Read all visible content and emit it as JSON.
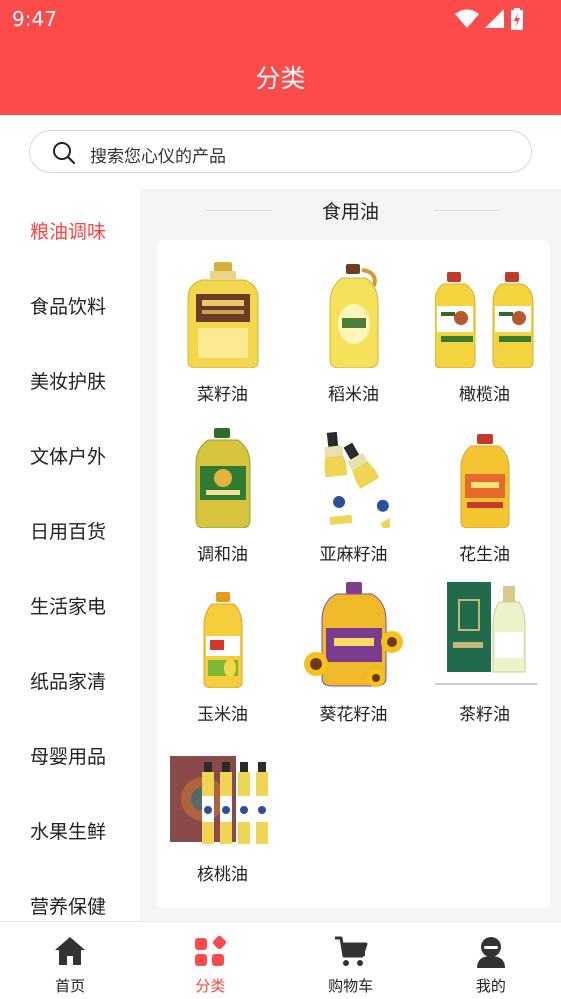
{
  "status_bar": {
    "time": "9:47"
  },
  "header": {
    "title": "分类"
  },
  "search": {
    "placeholder": "搜索您心仪的产品"
  },
  "sidebar": {
    "items": [
      {
        "label": "粮油调味",
        "active": true
      },
      {
        "label": "食品饮料"
      },
      {
        "label": "美妆护肤"
      },
      {
        "label": "文体户外"
      },
      {
        "label": "日用百货"
      },
      {
        "label": "生活家电"
      },
      {
        "label": "纸品家清"
      },
      {
        "label": "母婴用品"
      },
      {
        "label": "水果生鲜"
      },
      {
        "label": "营养保健"
      }
    ]
  },
  "content": {
    "category_title": "食用油",
    "products": [
      {
        "name": "菜籽油",
        "icon": "rapeseed-oil-bottle"
      },
      {
        "name": "稻米油",
        "icon": "rice-bran-oil-bottle"
      },
      {
        "name": "橄榄油",
        "icon": "olive-oil-bottles"
      },
      {
        "name": "调和油",
        "icon": "blended-oil-bottle"
      },
      {
        "name": "亚麻籽油",
        "icon": "linseed-oil-bottles"
      },
      {
        "name": "花生油",
        "icon": "peanut-oil-bottle"
      },
      {
        "name": "玉米油",
        "icon": "corn-oil-bottle"
      },
      {
        "name": "葵花籽油",
        "icon": "sunflower-oil-bottle"
      },
      {
        "name": "茶籽油",
        "icon": "tea-seed-oil-box"
      },
      {
        "name": "核桃油",
        "icon": "walnut-oil-gift-box"
      }
    ]
  },
  "tabbar": {
    "tabs": [
      {
        "label": "首页",
        "icon": "home-icon"
      },
      {
        "label": "分类",
        "icon": "category-icon",
        "active": true
      },
      {
        "label": "购物车",
        "icon": "cart-icon"
      },
      {
        "label": "我的",
        "icon": "profile-icon"
      }
    ]
  },
  "colors": {
    "brand": "#fd4b4b",
    "active_text": "#ff4444"
  }
}
